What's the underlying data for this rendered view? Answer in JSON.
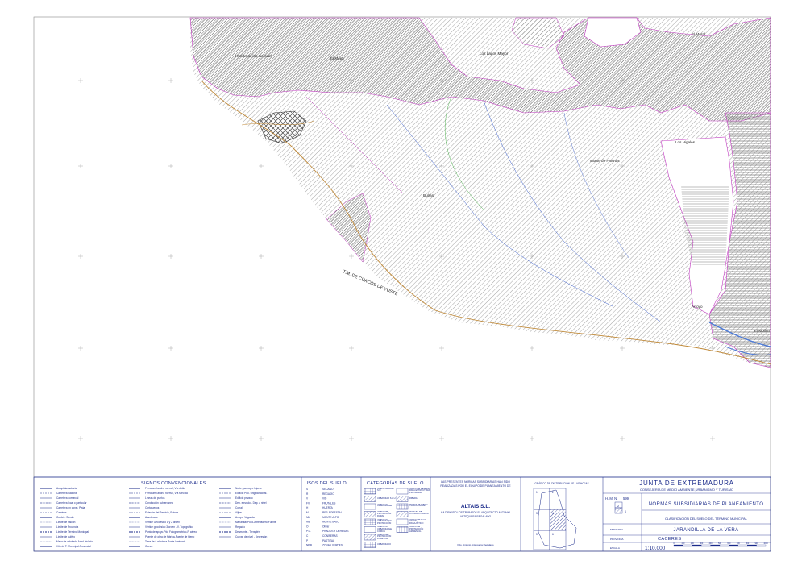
{
  "map": {
    "boundary_label": "T.M. DE CUACOS DE YUSTE",
    "places": [
      {
        "id": "huerto",
        "name": "Huerto de los Cerezos"
      },
      {
        "id": "mesa",
        "name": "El Mesa"
      },
      {
        "id": "loslagos",
        "name": "Los Lagos Mayor"
      },
      {
        "id": "elmoral",
        "name": "El Moral"
      },
      {
        "id": "loshigales",
        "name": "Los Higales"
      },
      {
        "id": "monte",
        "name": "Monte de Favinas"
      },
      {
        "id": "bulran",
        "name": "Bulran"
      },
      {
        "id": "arroyo",
        "name": "Arroyo"
      },
      {
        "id": "elmolino",
        "name": "El Molino"
      }
    ],
    "colors": {
      "hatch": "#555555",
      "boundary": "#c23ac2",
      "road": "#c08a3a",
      "stream": "#3a5fd0",
      "river": "#4d7bd8",
      "green": "#2aa62a"
    }
  },
  "legend": {
    "signos": {
      "title": "SIGNOS CONVENCIONALES",
      "col1": [
        "Autopista-Autovía",
        "Carretera nacional",
        "Carretera comarcal",
        "Carretera local o particular",
        "Carretera en const. Pista",
        "Caminos",
        "Cordel - Senda",
        "Límite de nación",
        "Límite de Provincia",
        "Límite de Término Municipal",
        "Límite de cultivo",
        "Masa de arbolado-Arbol aislado",
        "Hito de T. Municipal-Provincial"
      ],
      "col2": [
        "Ferrocarril ancho normal, Vía doble",
        "Ferrocarril ancho normal, Vía sencilla",
        "Líneas de puntos",
        "Conducción subterránea",
        "Cortafuegos",
        "Estación del Servicio, Ruinas",
        "Alambrada",
        "Vértice Geodésico 1 y 2 orden",
        "Vértice geodésico 3 orden - V. Topográfico",
        "Punto de apoyo-Pdo Fotogramétrico-P. aéreo",
        "Puente de obra de fábrica-Puente de hierro",
        "Torre de t. eléctrica-Poste-luminaria",
        "Cueva"
      ],
      "col3": [
        "Norte, parroq. o hijuela",
        "Edificio Pdo. singular-const.",
        "Edificio privado",
        "Dep. elevado - Dep. a nivel",
        "Corral",
        "Aljibe",
        "Arroyo. Vaguada",
        "Manantial-Pozo-Abrevadero-Fuente",
        "Regadío",
        "Desmonte - Terraplén",
        "Curvas de nivel - Depresión"
      ]
    },
    "usos": {
      "title": "USOS DEL SUELO",
      "codes": [
        "S",
        "R",
        "V",
        "FV",
        "H",
        "M",
        "Mb",
        "MB",
        "O",
        "P.G.",
        "C",
        "P",
        "NP.B"
      ],
      "names": [
        "SECANO",
        "REGADÍO",
        "VID",
        "FRUTALES",
        "HUERTA",
        "REP. FORESTAL",
        "MONTE ALTO",
        "MONTE BAJO",
        "Olivar",
        "PRADOS Y DEHESAS",
        "CONÍFERAS",
        "PASTIZAL",
        "ZONAS VERDES"
      ]
    },
    "categorias": {
      "title": "CATEGORÍAS DE SUELO",
      "items_left": [
        "SUELO URBANO S.U.",
        "SUELO APTO PARA URBANIZAR S.A.U.",
        "SUELO NO URBANIZABLE",
        "SUELO DE PROTECCIÓN RURAL",
        "SUELO NO URBANIZABLE PROTECCIÓN",
        "SUELO NO URBANIZABLE COMÚN",
        "SUELO DE PROTECCIÓN FORESTAL",
        "NÚCLEO URBANIZADO"
      ],
      "items_right": [
        "SUELO DE RESERVA PARA ESTRUCTURA PROTEGIDA",
        "CORREDOR DE RIBERA",
        "MASAS DE RIEGO TRADICIONALES",
        "MONTES DE UTILIDAD PÚBLICA",
        "SUELO DE ALTO VALOR PAISAJÍSTICO",
        "SUELO DE PROTECCIÓN AMBIENTAL"
      ]
    },
    "company": {
      "intro": "LAS PRESENTES NORMAS SUBSIDIARIAS HAN SIDO REALIZADAS POR EL EQUIPO DE PLANEAMIENTO DE",
      "name": "ALTAIS S.L.",
      "director": "HA DIRIGIDO LOS TRABAJOS EL ARQUITECTO ANTONIO ANTEQUERA REGALADO",
      "signature": "Fdo. Antonio Antequera Regalado"
    },
    "grafico_title": "GRÁFICO DE DISTRIBUCIÓN DE LAS HOJAS",
    "sheet_numbers": [
      "1",
      "2",
      "3",
      "4",
      "5",
      "6"
    ],
    "titleblock": {
      "org": "JUNTA DE EXTREMADURA",
      "dept": "CONSEJERÍA DE MEDIO AMBIENTE,URBANISMO Y TURISMO",
      "hmn_label": "H. M. N.",
      "hmn_value": "599",
      "hoja_num": "2",
      "hoja_total": "4",
      "title": "NORMAS SUBSIDIARIAS DE PLANEAMIENTO",
      "subtitle": "CLASIFICACIÓN DEL SUELO DEL TÉRMINO MUNICIPAL",
      "municipio_label": "MUNICIPIO",
      "municipio": "JARANDILLA DE LA VERA",
      "provincia_label": "PROVINCIA",
      "provincia": "CACERES",
      "escala_label": "ESCALA",
      "escala": "1:10.000",
      "bar_ticks": [
        "0",
        "100",
        "200",
        "300",
        "400",
        "500",
        "600",
        "700",
        "800",
        "900",
        "1000"
      ]
    }
  }
}
